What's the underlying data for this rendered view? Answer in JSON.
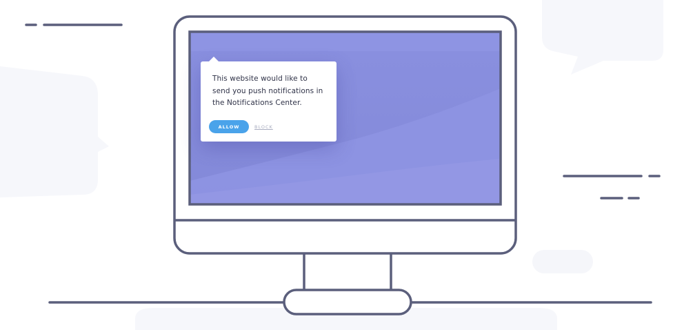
{
  "notification_popup": {
    "message": "This website would like to send you push notifications in the Notifications Center.",
    "allow_label": "ALLOW",
    "block_label": "BLOCK"
  },
  "colors": {
    "outline": "#5b5f7c",
    "screen": "#8a8fdd",
    "allow_button": "#4aa3ea",
    "background_shape": "#f5f6fa"
  }
}
